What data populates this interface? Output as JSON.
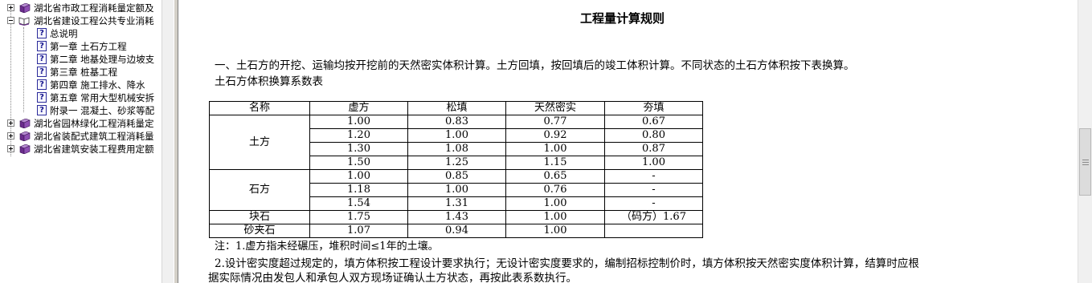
{
  "sidebar": {
    "items": [
      {
        "label": "湖北省市政工程消耗量定额及",
        "icon": "closed-book-icon",
        "expander": "plus"
      },
      {
        "label": "湖北省建设工程公共专业消耗",
        "icon": "open-book-icon",
        "expander": "minus"
      },
      {
        "label": "总说明",
        "icon": "help-page-icon"
      },
      {
        "label": "第一章  土石方工程",
        "icon": "help-page-icon"
      },
      {
        "label": "第二章  地基处理与边坡支",
        "icon": "help-page-icon"
      },
      {
        "label": "第三章  桩基工程",
        "icon": "help-page-icon"
      },
      {
        "label": "第四章  施工排水、降水",
        "icon": "help-page-icon"
      },
      {
        "label": "第五章  常用大型机械安拆",
        "icon": "help-page-icon"
      },
      {
        "label": "附录一  混凝土、砂浆等配",
        "icon": "help-page-icon"
      },
      {
        "label": "湖北省园林绿化工程消耗量定",
        "icon": "closed-book-icon",
        "expander": "plus"
      },
      {
        "label": "湖北省装配式建筑工程消耗量",
        "icon": "closed-book-icon",
        "expander": "plus"
      },
      {
        "label": "湖北省建筑安装工程费用定额",
        "icon": "closed-book-icon",
        "expander": "plus"
      }
    ]
  },
  "content": {
    "title": "工程量计算规则",
    "para1": "一、土石方的开挖、运输均按开挖前的天然密实体积计算。土方回填，按回填后的竣工体积计算。不同状态的土石方体积按下表换算。",
    "table_caption": "土石方体积换算系数表",
    "table": {
      "headers": [
        "名称",
        "虚方",
        "松填",
        "天然密实",
        "夯填"
      ],
      "groups": [
        {
          "name": "土方",
          "rows": [
            [
              "1.00",
              "0.83",
              "0.77",
              "0.67"
            ],
            [
              "1.20",
              "1.00",
              "0.92",
              "0.80"
            ],
            [
              "1.30",
              "1.08",
              "1.00",
              "0.87"
            ],
            [
              "1.50",
              "1.25",
              "1.15",
              "1.00"
            ]
          ]
        },
        {
          "name": "石方",
          "rows": [
            [
              "1.00",
              "0.85",
              "0.65",
              "-"
            ],
            [
              "1.18",
              "1.00",
              "0.76",
              "-"
            ],
            [
              "1.54",
              "1.31",
              "1.00",
              "-"
            ]
          ]
        },
        {
          "name": "块石",
          "rows": [
            [
              "1.75",
              "1.43",
              "1.00",
              "（码方）1.67"
            ]
          ]
        },
        {
          "name": "砂夹石",
          "rows": [
            [
              "1.07",
              "0.94",
              "1.00",
              ""
            ]
          ]
        }
      ]
    },
    "note1": "注：1.虚方指未经碾压，堆积时间≤1年的土壤。",
    "note2": "2.设计密实度超过规定的，填方体积按工程设计要求执行；无设计密实度要求的，编制招标控制价时，填方体积按天然密实度体积计算，结算时应根",
    "note3": "据实际情况由发包人和承包人双方现场证确认土方状态，再按此表系数执行。"
  },
  "colors": {
    "book_purple": "#6a2c8c",
    "help_blue": "#14148c",
    "splitter": "#d4d0c8"
  }
}
